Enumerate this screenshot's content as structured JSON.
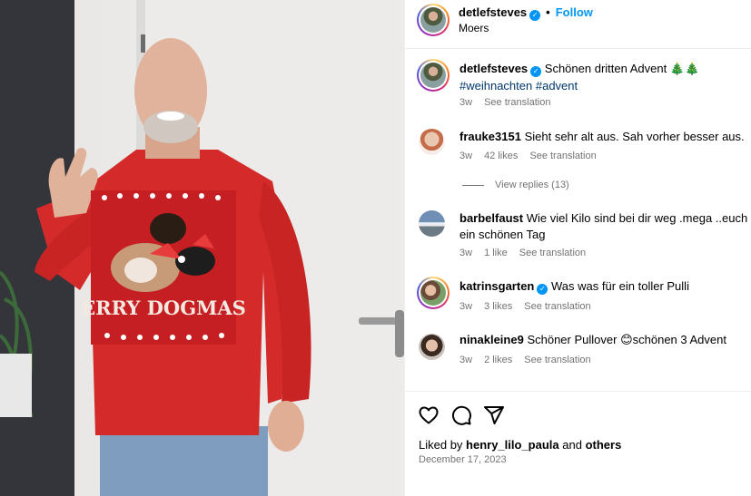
{
  "post": {
    "username": "detlefsteves",
    "follow_label": "Follow",
    "location": "Moers",
    "caption": "Schönen dritten Advent ",
    "caption_emoji": "🎄🎄",
    "hashtags": [
      "#weihnachten",
      "#advent"
    ],
    "caption_age": "3w",
    "see_translation": "See translation",
    "sweater_text": "ERRY DOGMAS"
  },
  "comments": [
    {
      "username": "frauke3151",
      "verified": false,
      "text": "Sieht sehr alt aus. Sah vorher besser aus.",
      "age": "3w",
      "likes": "42 likes",
      "translation": "See translation",
      "view_replies": "View replies (13)"
    },
    {
      "username": "barbelfaust",
      "verified": false,
      "text": "Wie viel Kilo sind bei dir weg .mega ..euch ein schönen Tag",
      "age": "3w",
      "likes": "1 like",
      "translation": "See translation"
    },
    {
      "username": "katrinsgarten",
      "verified": true,
      "text": "Was was für ein toller Pulli",
      "age": "3w",
      "likes": "3 likes",
      "translation": "See translation"
    },
    {
      "username": "ninakleine9",
      "verified": false,
      "text": "Schöner Pullover ",
      "emoji": "😊",
      "text_after": "schönen 3 Advent",
      "age": "3w",
      "likes": "2 likes",
      "translation": "See translation"
    }
  ],
  "footer": {
    "liked_prefix": "Liked by ",
    "liked_user": "henry_lilo_paula",
    "liked_and": " and ",
    "liked_others": "others",
    "date": "December 17, 2023"
  },
  "icons": {
    "like": "heart-icon",
    "comment": "comment-bubble-icon",
    "share": "paper-plane-icon",
    "verified": "verified-badge-icon"
  },
  "colors": {
    "link_blue": "#0095f6",
    "hashtag": "#00376b",
    "muted": "#737373",
    "sweater_red": "#d42a2a"
  }
}
